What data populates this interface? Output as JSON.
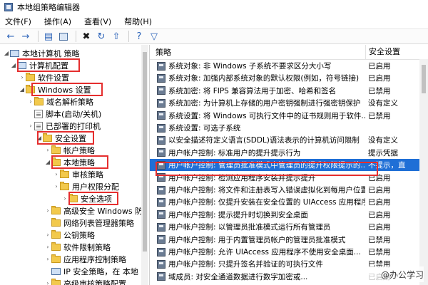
{
  "window": {
    "title": "本地组策略编辑器"
  },
  "menu": [
    "文件(F)",
    "操作(A)",
    "查看(V)",
    "帮助(H)"
  ],
  "toolbar_icons": [
    "back-icon",
    "forward-icon",
    "up-icon",
    "properties-icon",
    "delete-icon",
    "refresh-icon",
    "export-icon",
    "help-icon",
    "filter-icon"
  ],
  "tree": [
    {
      "label": "本地计算机 策略",
      "level": 0
    },
    {
      "label": "计算机配置",
      "level": 1
    },
    {
      "label": "软件设置",
      "level": 2
    },
    {
      "label": "Windows 设置",
      "level": 2
    },
    {
      "label": "域名解析策略",
      "level": 3
    },
    {
      "label": "脚本(启动/关机)",
      "level": 3
    },
    {
      "label": "已部署的打印机",
      "level": 3
    },
    {
      "label": "安全设置",
      "level": 3
    },
    {
      "label": "帐户策略",
      "level": 4
    },
    {
      "label": "本地策略",
      "level": 4
    },
    {
      "label": "审核策略",
      "level": 5
    },
    {
      "label": "用户权限分配",
      "level": 5
    },
    {
      "label": "安全选项",
      "level": 5
    },
    {
      "label": "高级安全 Windows 防",
      "level": 4
    },
    {
      "label": "网络列表管理器策略",
      "level": 4
    },
    {
      "label": "公钥策略",
      "level": 4
    },
    {
      "label": "软件限制策略",
      "level": 4
    },
    {
      "label": "应用程序控制策略",
      "level": 4
    },
    {
      "label": "IP 安全策略，在 本地",
      "level": 4
    },
    {
      "label": "高级审核策略配置",
      "level": 4
    }
  ],
  "list": {
    "header_policy": "策略",
    "header_setting": "安全设置",
    "rows": [
      {
        "policy": "系统对象: 非 Windows 子系统不要求区分大小写",
        "setting": "已启用"
      },
      {
        "policy": "系统对象: 加强内部系统对象的默认权限(例如，符号链接)",
        "setting": "已启用"
      },
      {
        "policy": "系统加密: 将 FIPS 兼容算法用于加密、哈希和签名",
        "setting": "已禁用"
      },
      {
        "policy": "系统加密: 为计算机上存储的用户密钥强制进行强密钥保护",
        "setting": "没有定义"
      },
      {
        "policy": "系统设置: 将 Windows 可执行文件中的证书规则用于软件...",
        "setting": "已禁用"
      },
      {
        "policy": "系统设置: 可选子系统",
        "setting": ""
      },
      {
        "policy": "以安全描述符定义语言(SDDL)语法表示的计算机访问限制",
        "setting": "没有定义"
      },
      {
        "policy": "用户帐户控制: 标准用户的提升提示行为",
        "setting": "提示凭据"
      },
      {
        "policy": "用户帐户控制: 管理员批准模式中管理员的提升权限提示的...",
        "setting": "不提示，直"
      },
      {
        "policy": "用户帐户控制: 检测应用程序安装并提示提升",
        "setting": "已启用"
      },
      {
        "policy": "用户帐户控制: 将文件和注册表写入错误虚拟化到每用户位置",
        "setting": "已启用"
      },
      {
        "policy": "用户帐户控制: 仅提升安装在安全位置的 UIAccess 应用程序",
        "setting": "已启用"
      },
      {
        "policy": "用户帐户控制: 提示提升时切换到安全桌面",
        "setting": "已启用"
      },
      {
        "policy": "用户帐户控制: 以管理员批准模式运行所有管理员",
        "setting": "已启用"
      },
      {
        "policy": "用户帐户控制: 用于内置管理员帐户的管理员批准模式",
        "setting": "已禁用"
      },
      {
        "policy": "用户帐户控制: 允许 UIAccess 应用程序不使用安全桌面...",
        "setting": "已禁用"
      },
      {
        "policy": "用户帐户控制: 只提升签名并验证的可执行文件",
        "setting": "已禁用"
      },
      {
        "policy": "域成员: 对安全通道数据进行数字加密或...",
        "setting": "已启用"
      }
    ]
  },
  "watermark": "@办公学习"
}
